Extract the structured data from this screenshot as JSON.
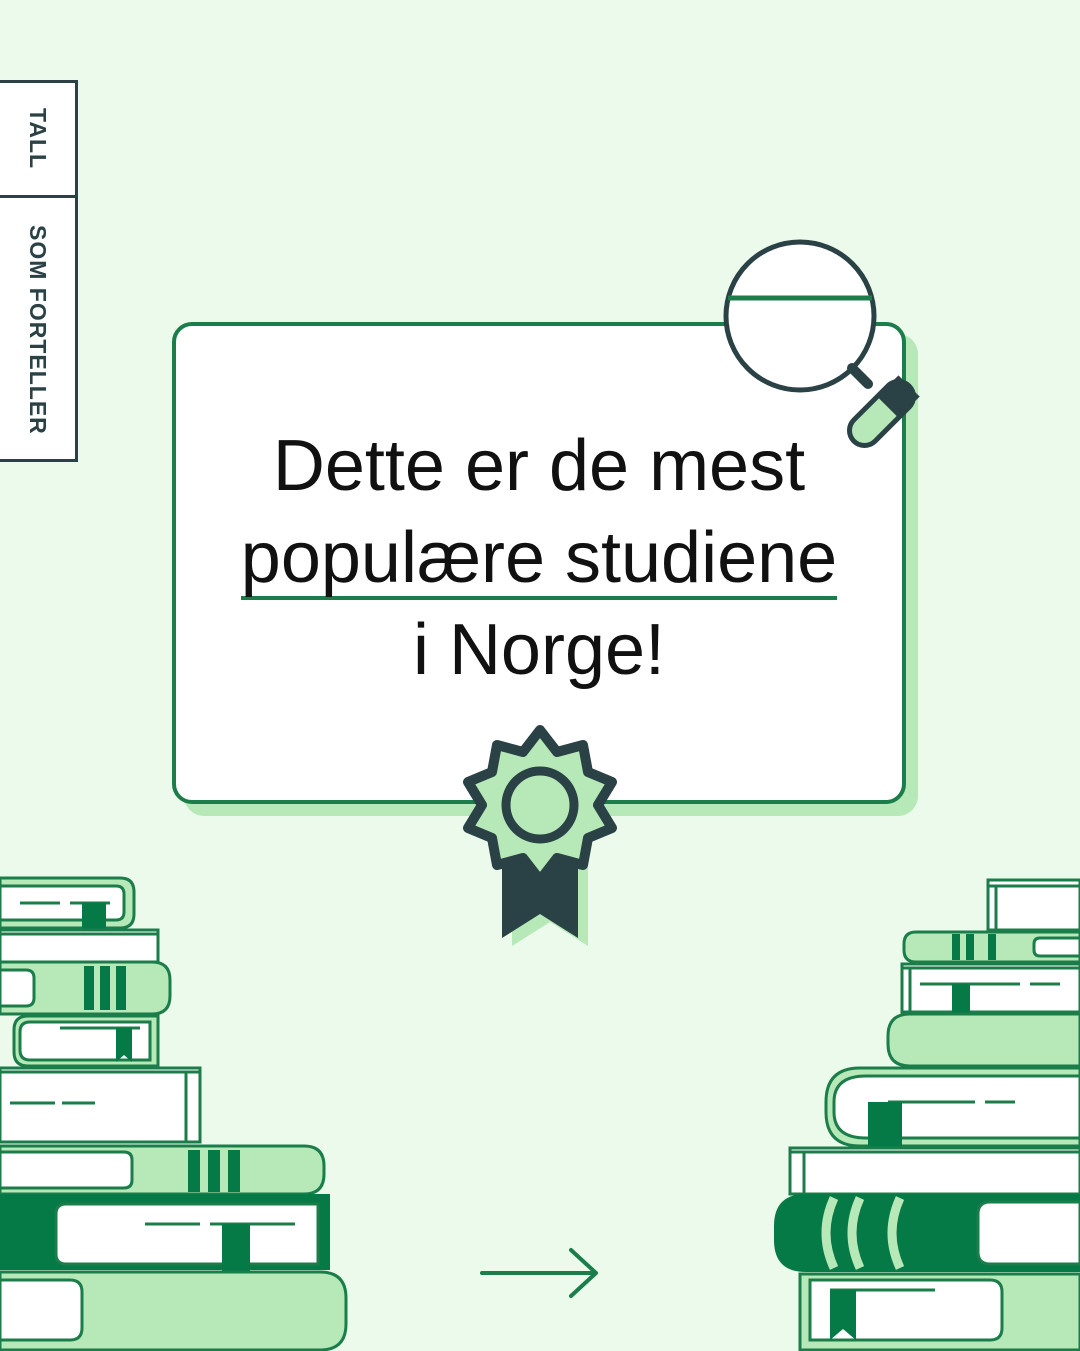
{
  "side_tag": {
    "line1": "TALL",
    "line2": "SOM FORTELLER"
  },
  "headline": {
    "line1": "Dette er de mest",
    "line2": "populære studiene",
    "line3": "i Norge!"
  },
  "colors": {
    "background": "#ebfaeb",
    "dark_green": "#1b7d4a",
    "medium_green": "#067a46",
    "light_green": "#b6e8b8",
    "dark_slate": "#2a4145"
  },
  "icons": {
    "magnifier": "magnifying-glass-icon",
    "rosette": "award-rosette-icon",
    "arrow": "arrow-right-icon",
    "books": "book-stack-icon"
  }
}
